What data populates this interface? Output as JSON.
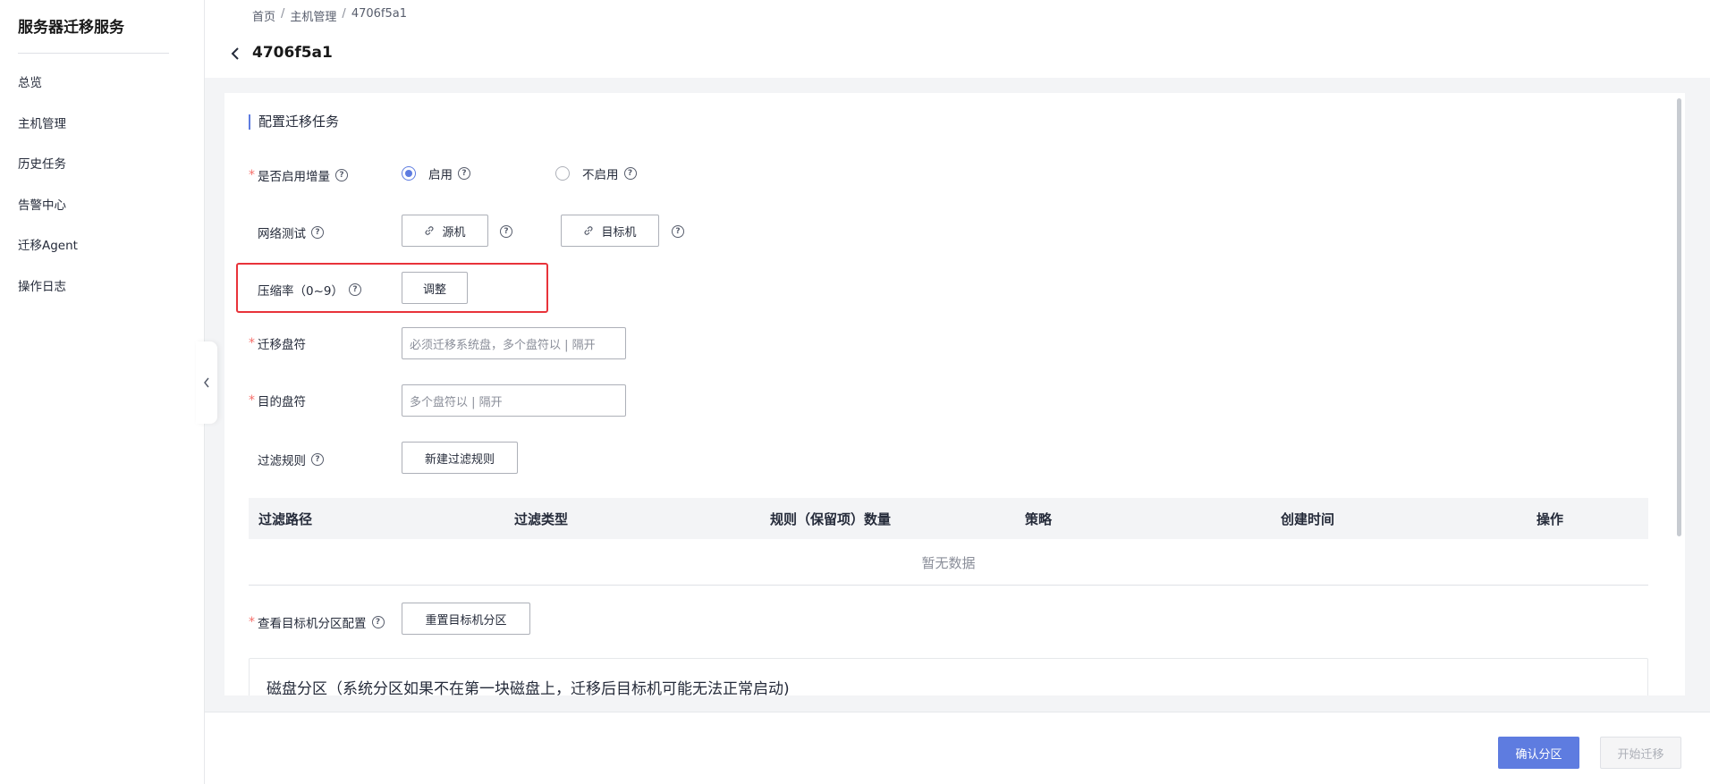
{
  "sidebar": {
    "title": "服务器迁移服务",
    "items": [
      {
        "label": "总览"
      },
      {
        "label": "主机管理"
      },
      {
        "label": "历史任务"
      },
      {
        "label": "告警中心"
      },
      {
        "label": "迁移Agent"
      },
      {
        "label": "操作日志"
      }
    ],
    "collapse_icon": "chevron-left-icon"
  },
  "header": {
    "breadcrumb": [
      "首页",
      "主机管理",
      "4706f5a1"
    ],
    "breadcrumb_sep": "/",
    "title": "4706f5a1",
    "back_icon": "chevron-left-icon"
  },
  "form": {
    "section_title": "配置迁移任务",
    "incremental": {
      "label": "是否启用增量",
      "required": true,
      "options": [
        {
          "label": "启用",
          "selected": true
        },
        {
          "label": "不启用",
          "selected": false
        }
      ]
    },
    "network_test": {
      "label": "网络测试",
      "source_button": "源机",
      "target_button": "目标机",
      "icon": "link-icon"
    },
    "compression": {
      "label": "压缩率（0~9）",
      "button": "调整"
    },
    "migrate_drives": {
      "label": "迁移盘符",
      "required": true,
      "placeholder": "必须迁移系统盘，多个盘符以 | 隔开",
      "value": ""
    },
    "target_drives": {
      "label": "目的盘符",
      "required": true,
      "placeholder": "多个盘符以 | 隔开",
      "value": ""
    },
    "filter_rules": {
      "label": "过滤规则",
      "button": "新建过滤规则"
    },
    "table": {
      "columns": [
        "过滤路径",
        "过滤类型",
        "规则（保留项）数量",
        "策略",
        "创建时间",
        "操作"
      ],
      "rows": [],
      "empty_text": "暂无数据"
    },
    "partition": {
      "label": "查看目标机分区配置",
      "required": true,
      "button": "重置目标机分区"
    },
    "disk_partition_title": "磁盘分区（系统分区如果不在第一块磁盘上，迁移后目标机可能无法正常启动)"
  },
  "footer": {
    "confirm_button": "确认分区",
    "start_button": "开始迁移"
  },
  "colors": {
    "accent": "#5e7ce0",
    "required": "#f66f6a",
    "highlight": "#e8333a"
  }
}
